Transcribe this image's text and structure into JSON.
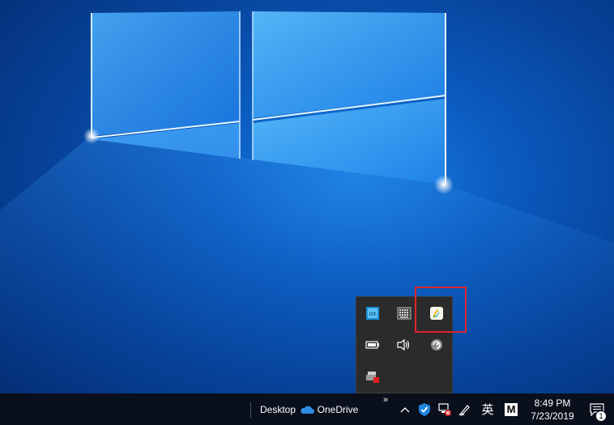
{
  "taskbar": {
    "desktop_label": "Desktop",
    "onedrive_label": "OneDrive",
    "toolbar_expand": "»",
    "show_hidden_icons": "^",
    "ime_label": "英",
    "m_app_label": "M",
    "time": "8:49 PM",
    "date": "7/23/2019",
    "notification_count": "1"
  },
  "tray_flyout": {
    "icons": [
      "intel-graphics-icon",
      "keyboard-icon",
      "qq-browser-icon",
      "battery-icon",
      "volume-icon",
      "sync-icon",
      "printer-error-icon"
    ]
  },
  "colors": {
    "highlight": "#e0242b",
    "taskbar_bg": "#0a0f1c",
    "flyout_bg": "#2b2b2b",
    "wallpaper_blue": "#0b5bbf"
  }
}
